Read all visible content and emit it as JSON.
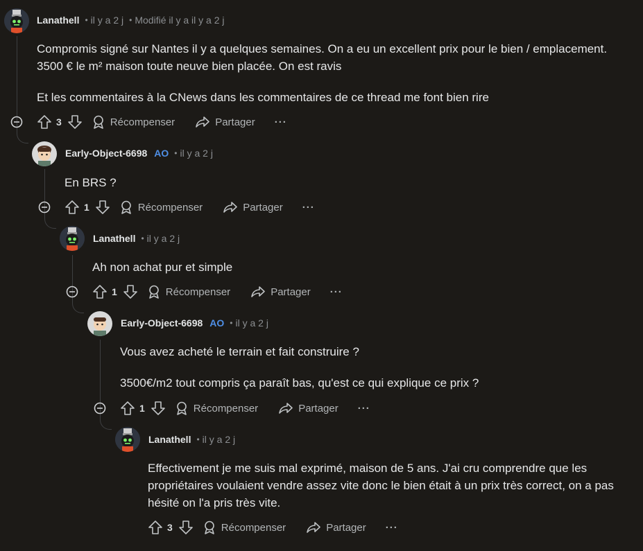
{
  "comments": [
    {
      "author": "Lanathell",
      "op_badge": "",
      "time": "il y a 2 j",
      "edited": "Modifié il y a il y a 2 j",
      "paragraphs": [
        "Compromis signé sur Nantes il y a quelques semaines. On a eu un excellent prix pour le bien / emplacement.",
        "3500 € le m² maison toute neuve bien placée. On est ravis",
        "Et les commentaires à la CNews dans les commentaires de ce thread me font bien rire"
      ],
      "votes": "3",
      "avatar": "robot-avatar"
    },
    {
      "author": "Early-Object-6698",
      "op_badge": "AO",
      "time": "il y a 2 j",
      "paragraphs": [
        "En BRS ?"
      ],
      "votes": "1",
      "avatar": "person-avatar"
    },
    {
      "author": "Lanathell",
      "time": "il y a 2 j",
      "paragraphs": [
        "Ah non achat pur et simple"
      ],
      "votes": "1",
      "avatar": "robot-avatar"
    },
    {
      "author": "Early-Object-6698",
      "op_badge": "AO",
      "time": "il y a 2 j",
      "paragraphs": [
        "Vous avez acheté le terrain et fait construire ?",
        "3500€/m2 tout compris ça paraît bas, qu'est ce qui explique ce prix ?"
      ],
      "votes": "1",
      "avatar": "person-avatar"
    },
    {
      "author": "Lanathell",
      "time": "il y a 2 j",
      "paragraphs": [
        "Effectivement je me suis mal exprimé, maison de 5 ans. J'ai cru comprendre que les propriétaires voulaient vendre assez vite donc le bien était à un prix très correct, on a pas hésité on l'a pris très vite."
      ],
      "votes": "3",
      "avatar": "robot-avatar"
    }
  ],
  "actions": {
    "award_label": "Récompenser",
    "share_label": "Partager",
    "more_label": "···"
  },
  "colors": {
    "background": "#1c1a17",
    "op_badge": "#4f8fe6",
    "thread_line": "#3e3f41"
  }
}
